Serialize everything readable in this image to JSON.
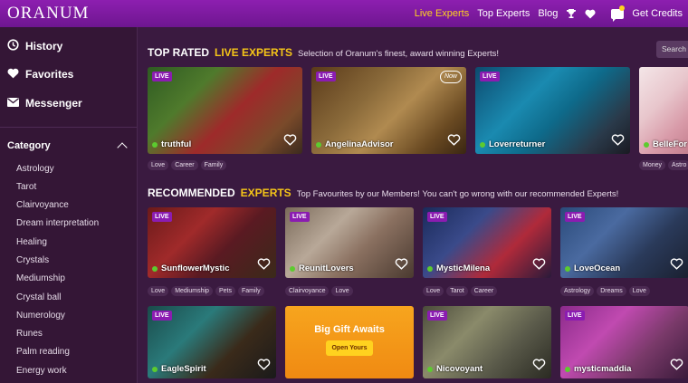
{
  "brand": {
    "logo": "ORANUM"
  },
  "nav": {
    "live_experts": "Live Experts",
    "top_experts": "Top Experts",
    "blog": "Blog",
    "get_credits": "Get Credits"
  },
  "sidebar": {
    "main_items": [
      {
        "label": "History",
        "icon": "clock-icon"
      },
      {
        "label": "Favorites",
        "icon": "heart-icon"
      },
      {
        "label": "Messenger",
        "icon": "envelope-icon"
      }
    ],
    "category_heading": "Category",
    "categories": [
      "Astrology",
      "Tarot",
      "Clairvoyance",
      "Dream interpretation",
      "Healing",
      "Crystals",
      "Mediumship",
      "Crystal ball",
      "Numerology",
      "Runes",
      "Palm reading",
      "Energy work"
    ]
  },
  "top_rated": {
    "title_white": "TOP RATED",
    "title_yellow": "LIVE EXPERTS",
    "subtitle": "Selection of Oranum's finest, award winning Experts!",
    "search_label": "Search f",
    "cards": [
      {
        "name": "truthful",
        "live": "LIVE",
        "tags": [
          "Love",
          "Career",
          "Family"
        ]
      },
      {
        "name": "AngelinaAdvisor",
        "live": "LIVE",
        "badge": "Now",
        "tags": []
      },
      {
        "name": "Loverreturner",
        "live": "LIVE",
        "tags": []
      },
      {
        "name": "BelleFor",
        "live": "",
        "tags": [
          "Money",
          "Astro"
        ]
      }
    ]
  },
  "recommended": {
    "title_white": "RECOMMENDED",
    "title_yellow": "EXPERTS",
    "subtitle": "Top Favourites by our Members! You can't go wrong with our recommended Experts!",
    "cards": [
      {
        "name": "SunflowerMystic",
        "live": "LIVE",
        "tags": [
          "Love",
          "Mediumship",
          "Pets",
          "Family"
        ]
      },
      {
        "name": "ReunitLovers",
        "live": "LIVE",
        "tags": [
          "Clairvoyance",
          "Love"
        ]
      },
      {
        "name": "MysticMilena",
        "live": "LIVE",
        "tags": [
          "Love",
          "Tarot",
          "Career"
        ]
      },
      {
        "name": "LoveOcean",
        "live": "LIVE",
        "tags": [
          "Astrology",
          "Dreams",
          "Love"
        ]
      }
    ]
  },
  "third_row": {
    "cards": [
      {
        "name": "EagleSpirit",
        "live": "LIVE"
      },
      {
        "name": "Nicovoyant",
        "live": "LIVE"
      },
      {
        "name": "mysticmaddia",
        "live": "LIVE"
      }
    ],
    "gift": {
      "title": "Big Gift Awaits",
      "button": "Open Yours"
    }
  },
  "colors": {
    "accent": "#ffd21f",
    "brand": "#8d1fb0",
    "online": "#5ccb2f"
  }
}
